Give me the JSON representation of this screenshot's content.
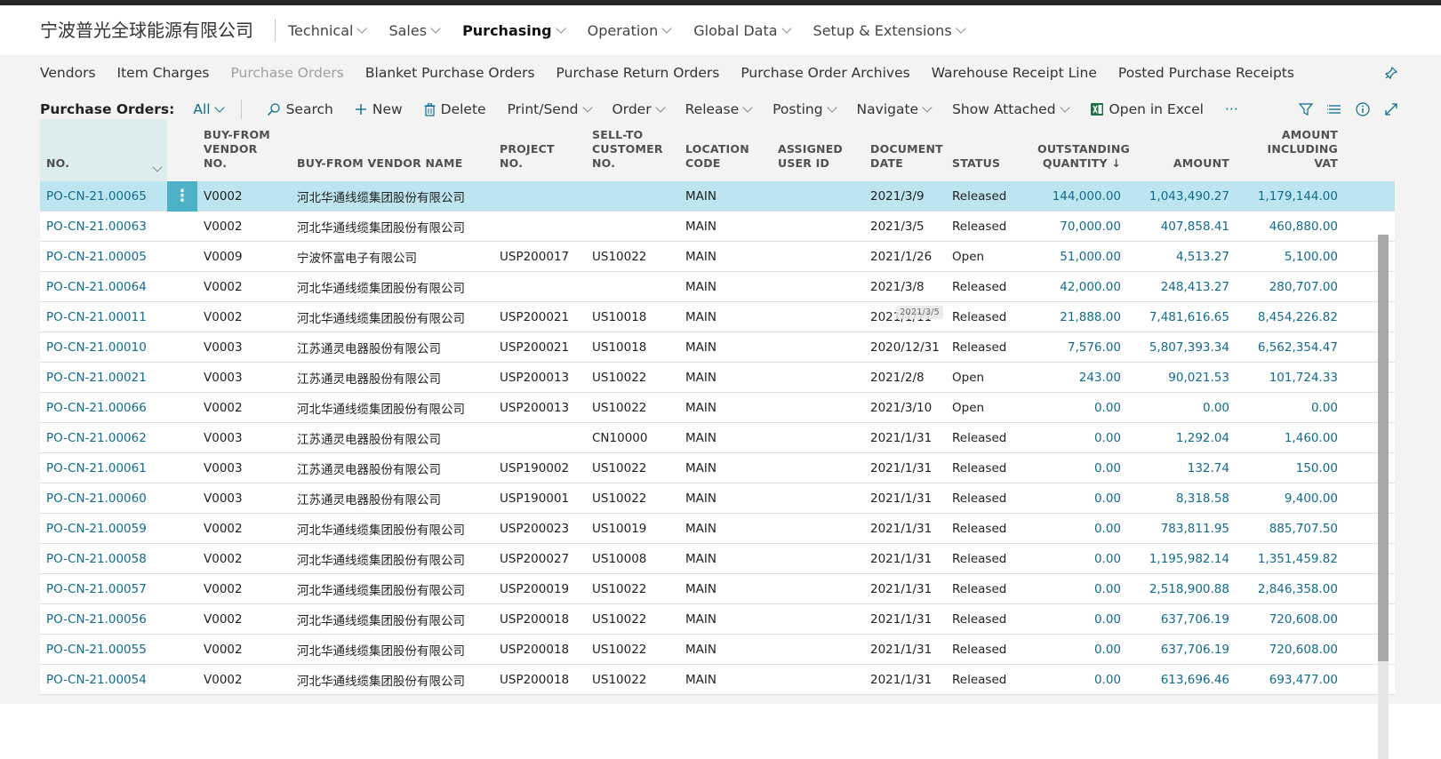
{
  "company": "宁波普光全球能源有限公司",
  "main_nav": [
    {
      "label": "Technical",
      "active": false
    },
    {
      "label": "Sales",
      "active": false
    },
    {
      "label": "Purchasing",
      "active": true
    },
    {
      "label": "Operation",
      "active": false
    },
    {
      "label": "Global Data",
      "active": false
    },
    {
      "label": "Setup & Extensions",
      "active": false
    }
  ],
  "nav_links": [
    {
      "label": "Vendors",
      "disabled": false
    },
    {
      "label": "Item Charges",
      "disabled": false
    },
    {
      "label": "Purchase Orders",
      "disabled": true
    },
    {
      "label": "Blanket Purchase Orders",
      "disabled": false
    },
    {
      "label": "Purchase Return Orders",
      "disabled": false
    },
    {
      "label": "Purchase Order Archives",
      "disabled": false
    },
    {
      "label": "Warehouse Receipt Line",
      "disabled": false
    },
    {
      "label": "Posted Purchase Receipts",
      "disabled": false
    }
  ],
  "action_bar": {
    "caption": "Purchase Orders:",
    "view": "All",
    "search": "Search",
    "new": "New",
    "delete": "Delete",
    "print_send": "Print/Send",
    "order": "Order",
    "release": "Release",
    "posting": "Posting",
    "navigate": "Navigate",
    "show_attached": "Show Attached",
    "open_excel": "Open in Excel",
    "more": "···"
  },
  "columns": {
    "no": "No.",
    "vendor_no_1": "Buy-from",
    "vendor_no_2": "Vendor No.",
    "vendor_name": "Buy-from Vendor Name",
    "project_no": "Project No.",
    "sell_to_1": "Sell-to",
    "sell_to_2": "Customer",
    "sell_to_3": "No.",
    "location_1": "Location",
    "location_2": "Code",
    "assigned_1": "Assigned",
    "assigned_2": "User ID",
    "doc_date_1": "Document",
    "doc_date_2": "Date",
    "status": "Status",
    "outstanding_1": "Outstanding",
    "outstanding_2": "Quantity",
    "amount": "Amount",
    "amount_vat_1": "Amount",
    "amount_vat_2": "Including VAT"
  },
  "tooltip": "2021/3/5",
  "rows": [
    {
      "no": "PO-CN-21.00065",
      "vendor_no": "V0002",
      "vendor_name": "河北华通线缆集团股份有限公司",
      "project_no": "",
      "sell_to": "",
      "location": "MAIN",
      "assigned": "",
      "doc_date": "2021/3/9",
      "status": "Released",
      "outstanding": "144,000.00",
      "amount": "1,043,490.27",
      "amount_vat": "1,179,144.00"
    },
    {
      "no": "PO-CN-21.00063",
      "vendor_no": "V0002",
      "vendor_name": "河北华通线缆集团股份有限公司",
      "project_no": "",
      "sell_to": "",
      "location": "MAIN",
      "assigned": "",
      "doc_date": "2021/3/5",
      "status": "Released",
      "outstanding": "70,000.00",
      "amount": "407,858.41",
      "amount_vat": "460,880.00"
    },
    {
      "no": "PO-CN-21.00005",
      "vendor_no": "V0009",
      "vendor_name": "宁波怀富电子有限公司",
      "project_no": "USP200017",
      "sell_to": "US10022",
      "location": "MAIN",
      "assigned": "",
      "doc_date": "2021/1/26",
      "status": "Open",
      "outstanding": "51,000.00",
      "amount": "4,513.27",
      "amount_vat": "5,100.00"
    },
    {
      "no": "PO-CN-21.00064",
      "vendor_no": "V0002",
      "vendor_name": "河北华通线缆集团股份有限公司",
      "project_no": "",
      "sell_to": "",
      "location": "MAIN",
      "assigned": "",
      "doc_date": "2021/3/8",
      "status": "Released",
      "outstanding": "42,000.00",
      "amount": "248,413.27",
      "amount_vat": "280,707.00"
    },
    {
      "no": "PO-CN-21.00011",
      "vendor_no": "V0002",
      "vendor_name": "河北华通线缆集团股份有限公司",
      "project_no": "USP200021",
      "sell_to": "US10018",
      "location": "MAIN",
      "assigned": "",
      "doc_date": "2021/1/11",
      "status": "Released",
      "outstanding": "21,888.00",
      "amount": "7,481,616.65",
      "amount_vat": "8,454,226.82"
    },
    {
      "no": "PO-CN-21.00010",
      "vendor_no": "V0003",
      "vendor_name": "江苏通灵电器股份有限公司",
      "project_no": "USP200021",
      "sell_to": "US10018",
      "location": "MAIN",
      "assigned": "",
      "doc_date": "2020/12/31",
      "status": "Released",
      "outstanding": "7,576.00",
      "amount": "5,807,393.34",
      "amount_vat": "6,562,354.47"
    },
    {
      "no": "PO-CN-21.00021",
      "vendor_no": "V0003",
      "vendor_name": "江苏通灵电器股份有限公司",
      "project_no": "USP200013",
      "sell_to": "US10022",
      "location": "MAIN",
      "assigned": "",
      "doc_date": "2021/2/8",
      "status": "Open",
      "outstanding": "243.00",
      "amount": "90,021.53",
      "amount_vat": "101,724.33"
    },
    {
      "no": "PO-CN-21.00066",
      "vendor_no": "V0002",
      "vendor_name": "河北华通线缆集团股份有限公司",
      "project_no": "USP200013",
      "sell_to": "US10022",
      "location": "MAIN",
      "assigned": "",
      "doc_date": "2021/3/10",
      "status": "Open",
      "outstanding": "0.00",
      "amount": "0.00",
      "amount_vat": "0.00"
    },
    {
      "no": "PO-CN-21.00062",
      "vendor_no": "V0003",
      "vendor_name": "江苏通灵电器股份有限公司",
      "project_no": "",
      "sell_to": "CN10000",
      "location": "MAIN",
      "assigned": "",
      "doc_date": "2021/1/31",
      "status": "Released",
      "outstanding": "0.00",
      "amount": "1,292.04",
      "amount_vat": "1,460.00"
    },
    {
      "no": "PO-CN-21.00061",
      "vendor_no": "V0003",
      "vendor_name": "江苏通灵电器股份有限公司",
      "project_no": "USP190002",
      "sell_to": "US10022",
      "location": "MAIN",
      "assigned": "",
      "doc_date": "2021/1/31",
      "status": "Released",
      "outstanding": "0.00",
      "amount": "132.74",
      "amount_vat": "150.00"
    },
    {
      "no": "PO-CN-21.00060",
      "vendor_no": "V0003",
      "vendor_name": "江苏通灵电器股份有限公司",
      "project_no": "USP190001",
      "sell_to": "US10022",
      "location": "MAIN",
      "assigned": "",
      "doc_date": "2021/1/31",
      "status": "Released",
      "outstanding": "0.00",
      "amount": "8,318.58",
      "amount_vat": "9,400.00"
    },
    {
      "no": "PO-CN-21.00059",
      "vendor_no": "V0002",
      "vendor_name": "河北华通线缆集团股份有限公司",
      "project_no": "USP200023",
      "sell_to": "US10019",
      "location": "MAIN",
      "assigned": "",
      "doc_date": "2021/1/31",
      "status": "Released",
      "outstanding": "0.00",
      "amount": "783,811.95",
      "amount_vat": "885,707.50"
    },
    {
      "no": "PO-CN-21.00058",
      "vendor_no": "V0002",
      "vendor_name": "河北华通线缆集团股份有限公司",
      "project_no": "USP200027",
      "sell_to": "US10008",
      "location": "MAIN",
      "assigned": "",
      "doc_date": "2021/1/31",
      "status": "Released",
      "outstanding": "0.00",
      "amount": "1,195,982.14",
      "amount_vat": "1,351,459.82"
    },
    {
      "no": "PO-CN-21.00057",
      "vendor_no": "V0002",
      "vendor_name": "河北华通线缆集团股份有限公司",
      "project_no": "USP200019",
      "sell_to": "US10022",
      "location": "MAIN",
      "assigned": "",
      "doc_date": "2021/1/31",
      "status": "Released",
      "outstanding": "0.00",
      "amount": "2,518,900.88",
      "amount_vat": "2,846,358.00"
    },
    {
      "no": "PO-CN-21.00056",
      "vendor_no": "V0002",
      "vendor_name": "河北华通线缆集团股份有限公司",
      "project_no": "USP200018",
      "sell_to": "US10022",
      "location": "MAIN",
      "assigned": "",
      "doc_date": "2021/1/31",
      "status": "Released",
      "outstanding": "0.00",
      "amount": "637,706.19",
      "amount_vat": "720,608.00"
    },
    {
      "no": "PO-CN-21.00055",
      "vendor_no": "V0002",
      "vendor_name": "河北华通线缆集团股份有限公司",
      "project_no": "USP200018",
      "sell_to": "US10022",
      "location": "MAIN",
      "assigned": "",
      "doc_date": "2021/1/31",
      "status": "Released",
      "outstanding": "0.00",
      "amount": "637,706.19",
      "amount_vat": "720,608.00"
    },
    {
      "no": "PO-CN-21.00054",
      "vendor_no": "V0002",
      "vendor_name": "河北华通线缆集团股份有限公司",
      "project_no": "USP200018",
      "sell_to": "US10022",
      "location": "MAIN",
      "assigned": "",
      "doc_date": "2021/1/31",
      "status": "Released",
      "outstanding": "0.00",
      "amount": "613,696.46",
      "amount_vat": "693,477.00"
    }
  ]
}
